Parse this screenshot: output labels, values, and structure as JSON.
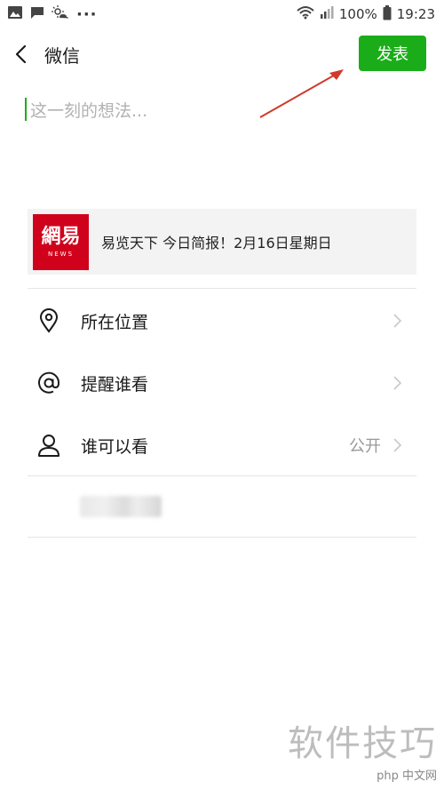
{
  "status_bar": {
    "battery": "100%",
    "time": "19:23",
    "dots": "···"
  },
  "header": {
    "title": "微信",
    "publish_label": "发表"
  },
  "composer": {
    "placeholder": "这一刻的想法..."
  },
  "link_card": {
    "logo_text": "網易",
    "logo_sub": "NEWS",
    "title": "易览天下 今日简报！2月16日星期日"
  },
  "options": [
    {
      "label": "所在位置",
      "icon": "location-pin-icon",
      "value": ""
    },
    {
      "label": "提醒谁看",
      "icon": "at-sign-icon",
      "value": ""
    },
    {
      "label": "谁可以看",
      "icon": "person-icon",
      "value": "公开"
    }
  ],
  "watermark": {
    "main": "软件技巧",
    "sub": "php 中文网"
  },
  "colors": {
    "accent": "#1aad19",
    "logo_red": "#d0021b",
    "annotation_arrow": "#d0392b"
  }
}
